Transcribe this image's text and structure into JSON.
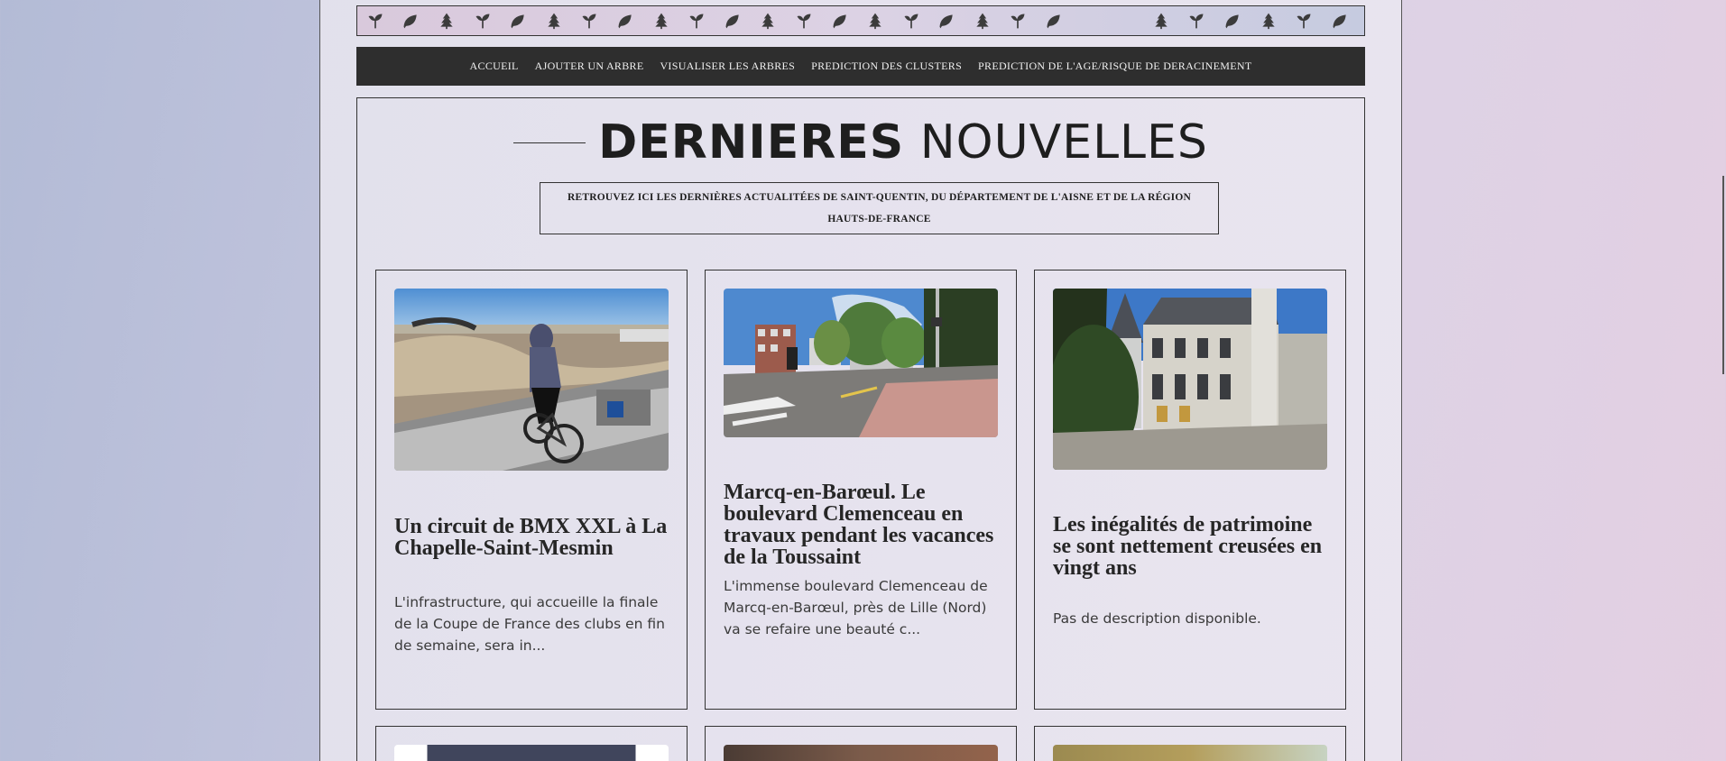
{
  "nav": {
    "items": [
      "ACCUEIL",
      "AJOUTER UN ARBRE",
      "VISUALISER LES ARBRES",
      "PREDICTION DES CLUSTERS",
      "PREDICTION DE L'AGE/RISQUE DE DERACINEMENT"
    ]
  },
  "header": {
    "title_bold": "DERNIERES",
    "title_light": "NOUVELLES",
    "subtitle": "RETROUVEZ ICI LES DERNIÈRES ACTUALITÉES DE SAINT-QUENTIN, DU DÉPARTEMENT DE L'AISNE ET DE LA RÉGION HAUTS-DE-FRANCE"
  },
  "pattern": {
    "icons": [
      "sprout-icon",
      "leaf-icon",
      "pine-tree-icon",
      "sprout-icon",
      "leaf-icon",
      "pine-tree-icon",
      "sprout-icon",
      "leaf-icon",
      "pine-tree-icon",
      "sprout-icon",
      "leaf-icon",
      "pine-tree-icon",
      "sprout-icon",
      "leaf-icon",
      "pine-tree-icon",
      "sprout-icon",
      "leaf-icon",
      "pine-tree-icon",
      "sprout-icon",
      "leaf-icon",
      "",
      "",
      "pine-tree-icon",
      "sprout-icon",
      "leaf-icon",
      "pine-tree-icon",
      "sprout-icon",
      "leaf-icon",
      "pine-tree-icon"
    ]
  },
  "articles": [
    {
      "title": "Un circuit de BMX XXL à La Chapelle-Saint-Mesmin",
      "description": "L'infrastructure, qui accueille la finale de la Coupe de France des clubs en fin de semaine, sera in...",
      "image_alt": "BMX rider on a start ramp"
    },
    {
      "title": "Marcq-en-Barœul. Le boulevard Clemenceau en travaux pendant les vacances de la Toussaint",
      "description": "L'immense boulevard Clemenceau de Marcq-en-Barœul, près de Lille (Nord) va se refaire une beauté c...",
      "image_alt": "Boulevard with trees and crosswalk"
    },
    {
      "title": "Les inégalités de patrimoine se sont nettement creusées en vingt ans",
      "description": "Pas de description disponible.",
      "image_alt": "Old château courtyard"
    }
  ],
  "colors": {
    "navbar_bg": "#2e2e2e",
    "text_dark": "#1e1e1e",
    "border": "#333333"
  }
}
